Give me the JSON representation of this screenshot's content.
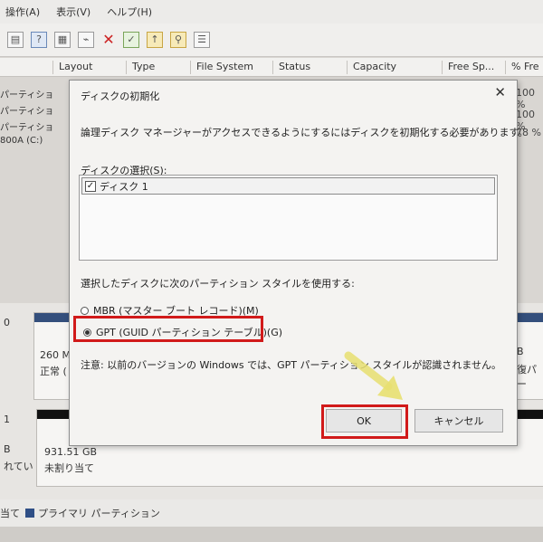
{
  "menubar": {
    "items": [
      "操作(A)",
      "表示(V)",
      "ヘルプ(H)"
    ]
  },
  "volume_table": {
    "columns": [
      "Layout",
      "Type",
      "File System",
      "Status",
      "Capacity",
      "Free Sp...",
      "% Fre"
    ],
    "rows": [
      {
        "name": "パーティショ",
        "pct": "100 %"
      },
      {
        "name": "パーティショ",
        "pct": "100 %"
      },
      {
        "name": "パーティショ",
        "pct": "78 %"
      },
      {
        "name": "800A (C:)",
        "pct": ""
      }
    ]
  },
  "disk_panel": {
    "disk0": {
      "label": "0",
      "part_size": "260 M",
      "part_status": "正常 (",
      "right_a": "B",
      "right_b": "復パー"
    },
    "disk1": {
      "label": "1",
      "left_a": "B",
      "left_b": "れてい",
      "size": "931.51 GB",
      "status": "未割り当て"
    }
  },
  "legend": {
    "unallocated": "当て",
    "primary": "プライマリ パーティション"
  },
  "dialog": {
    "title": "ディスクの初期化",
    "message": "論理ディスク マネージャーがアクセスできるようにするにはディスクを初期化する必要があります。",
    "select_label": "ディスクの選択(S):",
    "disk_item": "ディスク 1",
    "check_mark": "✓",
    "style_label": "選択したディスクに次のパーティション スタイルを使用する:",
    "mbr_label": "MBR (マスター ブート レコード)(M)",
    "gpt_label": "GPT (GUID パーティション テーブル)(G)",
    "note": "注意: 以前のバージョンの Windows では、GPT パーティション スタイルが認識されません。",
    "ok_label": "OK",
    "cancel_label": "キャンセル",
    "close_glyph": "✕"
  },
  "colors": {
    "highlight": "#d11a1a",
    "arrow": "#e8e070",
    "volume_bar": "#344f7c"
  }
}
